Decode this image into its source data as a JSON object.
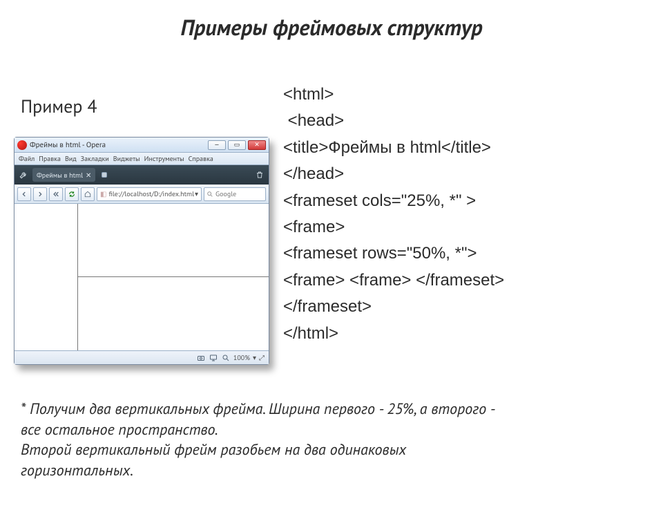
{
  "slide": {
    "title": "Примеры фреймовых структур",
    "example_label": "Пример 4"
  },
  "opera": {
    "window_title": "Фреймы в html - Opera",
    "win_buttons": {
      "min": "—",
      "max": "▭",
      "close": "✕"
    },
    "menu": [
      "Файл",
      "Правка",
      "Вид",
      "Закладки",
      "Виджеты",
      "Инструменты",
      "Справка"
    ],
    "tab_label": "Фреймы в html",
    "tab_close": "✕",
    "url": "file://localhost/D:/index.html",
    "url_dropdown": "▾",
    "search_placeholder": "Google",
    "status": {
      "zoom_down": "▾",
      "zoom": "100%",
      "expand": "⤢"
    }
  },
  "code": {
    "lines": [
      "<html>",
      " <head>",
      "<title>Фреймы в html</title>",
      "</head>",
      "<frameset cols=\"25%, *\" >",
      "<frame>",
      "<frameset rows=\"50%, *\">",
      "<frame> <frame> </frameset>",
      "</frameset>",
      "</html>"
    ]
  },
  "notes": {
    "line1": "* Получим два вертикальных фрейма. Ширина первого - 25%, а второго -",
    "line2": "все остальное пространство.",
    "line3": "Второй вертикальный фрейм разобьем на два одинаковых",
    "line4": "горизонтальных."
  },
  "icons": {
    "wrench": "wrench-icon",
    "reload": "reload-icon",
    "world": "world-icon",
    "magnifier": "magnifier-icon",
    "camera": "camera-icon",
    "monitor": "monitor-icon"
  }
}
